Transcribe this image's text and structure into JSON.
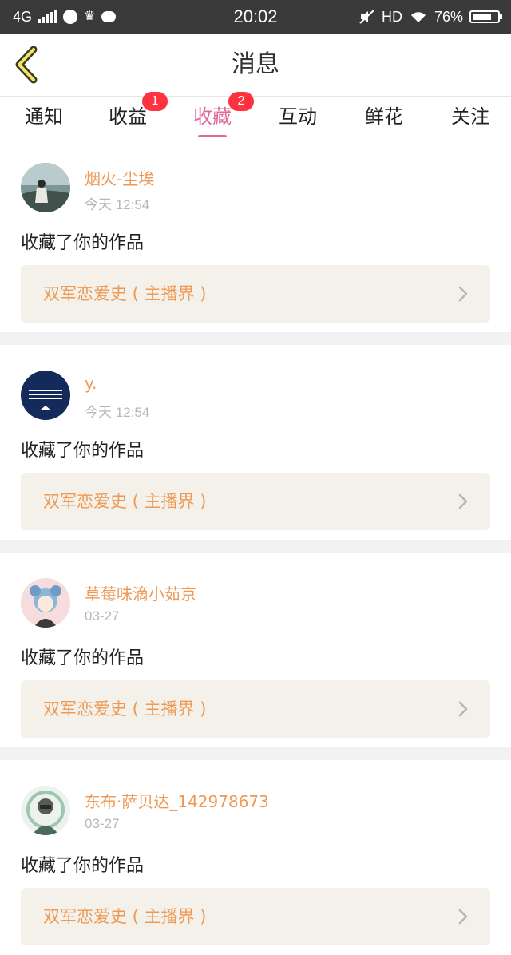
{
  "status_bar": {
    "network": "4G",
    "time": "20:02",
    "hd": "HD",
    "battery": "76%",
    "battery_level": 0.76
  },
  "header": {
    "title": "消息"
  },
  "tabs": [
    {
      "label": "通知",
      "badge": ""
    },
    {
      "label": "收益",
      "badge": "1"
    },
    {
      "label": "收藏",
      "badge": "2"
    },
    {
      "label": "互动",
      "badge": ""
    },
    {
      "label": "鲜花",
      "badge": ""
    },
    {
      "label": "关注",
      "badge": ""
    }
  ],
  "active_tab": "收藏",
  "items": [
    {
      "user": "烟火-尘埃",
      "time": "今天 12:54",
      "action": "收藏了你的作品",
      "work": "双军恋爱史 ( 主播界 )"
    },
    {
      "user": "y.",
      "time": "今天 12:54",
      "action": "收藏了你的作品",
      "work": "双军恋爱史 ( 主播界 )"
    },
    {
      "user": "草莓味滴小茹京",
      "time": "03-27",
      "action": "收藏了你的作品",
      "work": "双军恋爱史 ( 主播界 )"
    },
    {
      "user": "东布·萨贝达_142978673",
      "time": "03-27",
      "action": "收藏了你的作品",
      "work": "双军恋爱史 ( 主播界 )"
    }
  ],
  "colors": {
    "accent": "#e06a9a",
    "username": "#ee9a56",
    "badge": "#ff3340",
    "card_bg": "#f3f1e9"
  }
}
